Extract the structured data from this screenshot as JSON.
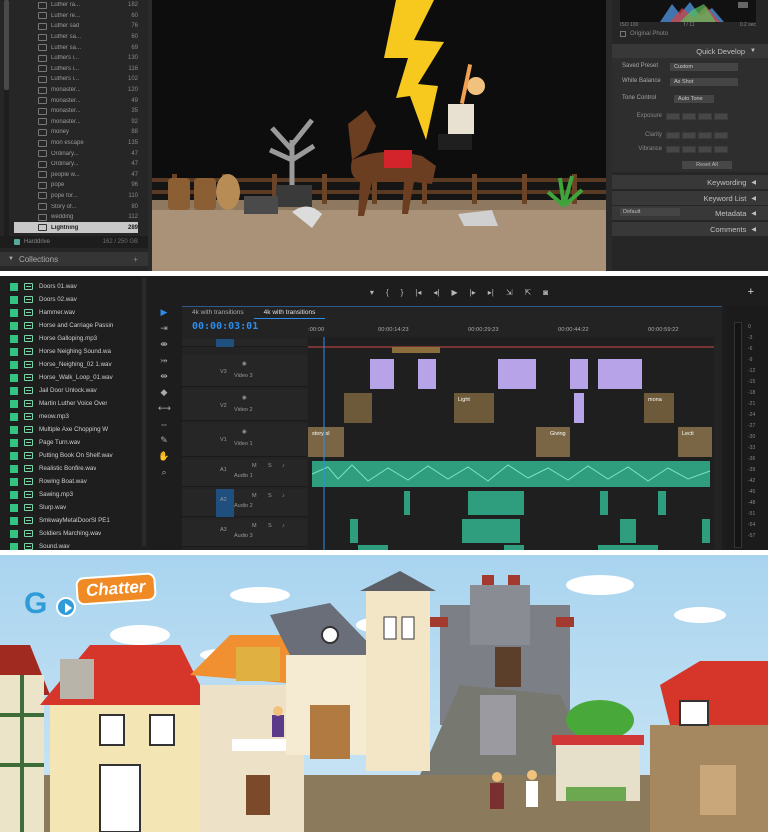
{
  "lightroom": {
    "collections": [
      {
        "name": "Luther ra...",
        "count": "182"
      },
      {
        "name": "Luther re...",
        "count": "60"
      },
      {
        "name": "Luther sad",
        "count": "76"
      },
      {
        "name": "Luther sa...",
        "count": "60"
      },
      {
        "name": "Luther sa...",
        "count": "69"
      },
      {
        "name": "Luthers i...",
        "count": "130"
      },
      {
        "name": "Luthers i...",
        "count": "116"
      },
      {
        "name": "Luthers i...",
        "count": "102"
      },
      {
        "name": "monaster...",
        "count": "120"
      },
      {
        "name": "monaster...",
        "count": "49"
      },
      {
        "name": "monaster...",
        "count": "35"
      },
      {
        "name": "monaster...",
        "count": "92"
      },
      {
        "name": "money",
        "count": "88"
      },
      {
        "name": "mon escape",
        "count": "135"
      },
      {
        "name": "Ordinary...",
        "count": "47"
      },
      {
        "name": "Ordinary...",
        "count": "47"
      },
      {
        "name": "people w...",
        "count": "47"
      },
      {
        "name": "pope",
        "count": "96"
      },
      {
        "name": "pope for...",
        "count": "110"
      },
      {
        "name": "Story of...",
        "count": "80"
      },
      {
        "name": "wedding",
        "count": "112"
      },
      {
        "name": "Lightning",
        "count": "289"
      }
    ],
    "drive": {
      "name": "Harddrive",
      "size": "162 / 250 GB"
    },
    "collections_header": "Collections",
    "histogram_info": {
      "iso": "ISO 100",
      "aperture": "f / 11",
      "shutter": "0.2 sec"
    },
    "original_photo": "Original Photo",
    "quick_develop": "Quick Develop",
    "saved_preset": {
      "label": "Saved Preset",
      "value": "Custom"
    },
    "white_balance": {
      "label": "White Balance",
      "value": "As Shot"
    },
    "tone_control": {
      "label": "Tone Control",
      "value": "Auto Tone"
    },
    "exposure": "Exposure",
    "clarity": "Clarity",
    "vibrance": "Vibrance",
    "reset_all": "Reset All",
    "keywording": "Keywording",
    "keyword_list": "Keyword List",
    "metadata_preset": "Default",
    "metadata": "Metadata",
    "comments": "Comments",
    "colors": {
      "selected": "#c8c8c8",
      "panel": "#262626"
    }
  },
  "premiere": {
    "audio_files": [
      "Doors 01.wav",
      "Doors 02.wav",
      "Hammer.wav",
      "Horse and Carriage Passin",
      "Horse Galloping.mp3",
      "Horse Neighing Sound.wa",
      "Horse_Neighing_02 1.wav",
      "Horse_Walk_Loop_01.wav",
      "Jail Door Unlock.wav",
      "Martin Luther Voice Over",
      "meow.mp3",
      "Multiple Axe Chopping W",
      "Page Turn.wav",
      "Putting Book On Shelf.wav",
      "Realistic Bonfire.wav",
      "Rowing Boat.wav",
      "Sawing.mp3",
      "Slurp.wav",
      "SmkwayMetalDoorSl PE1",
      "Soldiers Marching.wav",
      "Sound.wav"
    ],
    "tabs": [
      "4k with transitions",
      "4k with transitions"
    ],
    "timecode": "00:00:03:01",
    "ruler": [
      ":00:00",
      "00:00:14:23",
      "00:00:29:23",
      "00:00:44:22",
      "00:00:59:22"
    ],
    "video_tracks": [
      {
        "id": "V3",
        "name": "Video 3"
      },
      {
        "id": "V2",
        "name": "Video 2"
      },
      {
        "id": "V1",
        "name": "Video 1"
      }
    ],
    "audio_tracks": [
      {
        "id": "A1",
        "name": "Audio 1"
      },
      {
        "id": "A2",
        "name": "Audio 2"
      },
      {
        "id": "A3",
        "name": "Audio 3"
      }
    ],
    "clip_labels": [
      "story sl",
      "Light",
      "mona",
      "Giving",
      "Lecti"
    ],
    "meter_labels": [
      "0",
      "-3",
      "-6",
      "-9",
      "-12",
      "-15",
      "-18",
      "-21",
      "-24",
      "-27",
      "-30",
      "-33",
      "-36",
      "-39",
      "-42",
      "-45",
      "-48",
      "-51",
      "-54",
      "-57"
    ],
    "colors": {
      "audio_clip": "#2f9e7e",
      "video_clip": "#b7a3e8",
      "accent": "#2d8ceb"
    }
  },
  "gochatter": {
    "logo_letter": "G",
    "logo_word": "Chatter",
    "colors": {
      "brand_blue": "#2f9bd7",
      "brand_orange": "#f08a24"
    }
  }
}
